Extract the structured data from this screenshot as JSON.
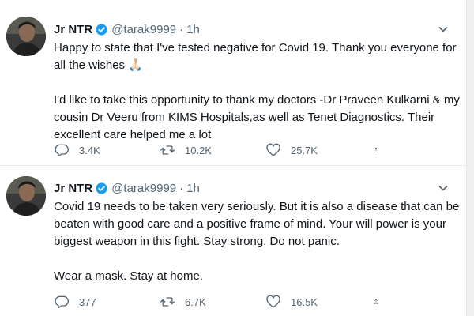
{
  "tweets": [
    {
      "author": "Jr NTR",
      "handle": "@tarak9999",
      "separator": "·",
      "time": "1h",
      "paragraphs": [
        "Happy to state that I've tested negative for Covid 19. Thank you everyone for all the wishes 🙏🏻",
        "I'd like to take this opportunity to thank my doctors -Dr Praveen Kulkarni & my cousin Dr Veeru from KIMS Hospitals,as well as Tenet Diagnostics. Their excellent care helped me a lot"
      ],
      "replies": "3.4K",
      "retweets": "10.2K",
      "likes": "25.7K"
    },
    {
      "author": "Jr NTR",
      "handle": "@tarak9999",
      "separator": "·",
      "time": "1h",
      "paragraphs": [
        "Covid 19 needs to be taken very seriously. But it is also a disease that can be beaten with good care and a positive frame of mind. Your will power is your biggest weapon in this fight. Stay strong. Do not panic.",
        "Wear a mask. Stay at home."
      ],
      "replies": "377",
      "retweets": "6.7K",
      "likes": "16.5K"
    }
  ],
  "icons": {
    "verified": "verified-badge-icon",
    "more": "chevron-down-icon",
    "reply": "reply-icon",
    "retweet": "retweet-icon",
    "like": "heart-icon",
    "share": "share-icon"
  },
  "colors": {
    "verified_blue": "#1d9bf0",
    "secondary_text": "#536471",
    "primary_text": "#0f1419"
  }
}
